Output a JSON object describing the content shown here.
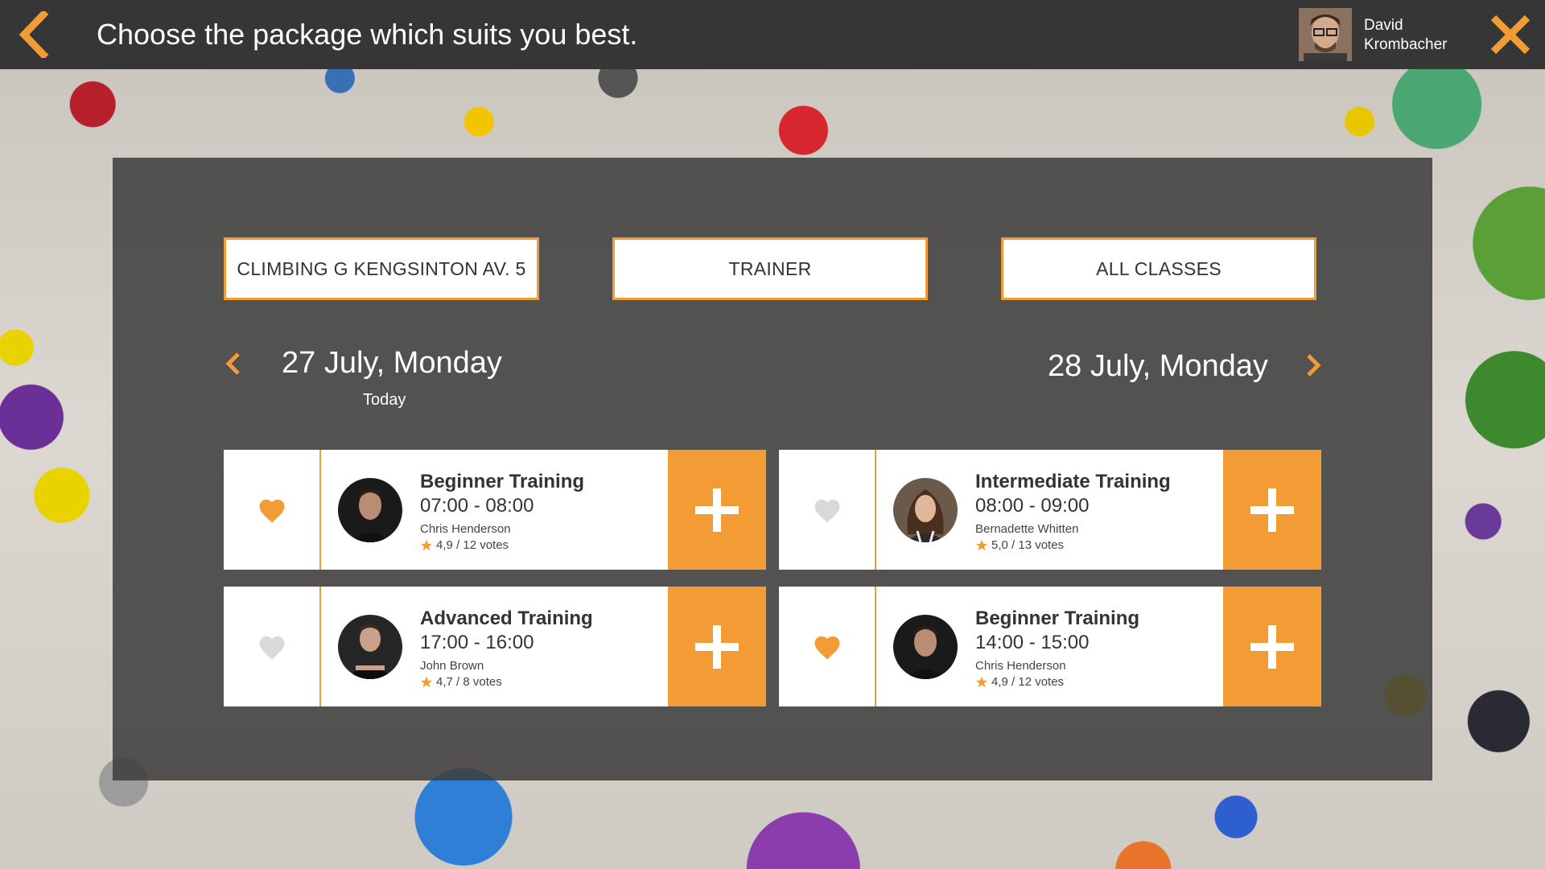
{
  "header": {
    "title": "Choose the package which suits you best.",
    "user": {
      "first_name": "David",
      "last_name": "Krombacher"
    }
  },
  "filters": [
    {
      "label": "CLIMBING G KENGSINTON AV. 5"
    },
    {
      "label": "TRAINER"
    },
    {
      "label": "ALL CLASSES"
    }
  ],
  "dates": {
    "current": "27 July, Monday",
    "current_note": "Today",
    "next": "28 July, Monday"
  },
  "classes": [
    {
      "title": "Beginner Training",
      "time": "07:00 - 08:00",
      "trainer": "Chris Henderson",
      "rating": "4,9 / 12 votes",
      "favorite": true
    },
    {
      "title": "Intermediate Training",
      "time": "08:00 - 09:00",
      "trainer": "Bernadette Whitten",
      "rating": "5,0 / 13 votes",
      "favorite": false
    },
    {
      "title": "Advanced Training",
      "time": "17:00 - 16:00",
      "trainer": "John Brown",
      "rating": "4,7 / 8 votes",
      "favorite": false
    },
    {
      "title": "Beginner Training",
      "time": "14:00 - 15:00",
      "trainer": "Chris Henderson",
      "rating": "4,9 / 12 votes",
      "favorite": true
    }
  ],
  "colors": {
    "accent": "#f39c35",
    "topbar": "#363636",
    "panel": "#3c3c3c",
    "heart_inactive": "#d9d9d9"
  }
}
